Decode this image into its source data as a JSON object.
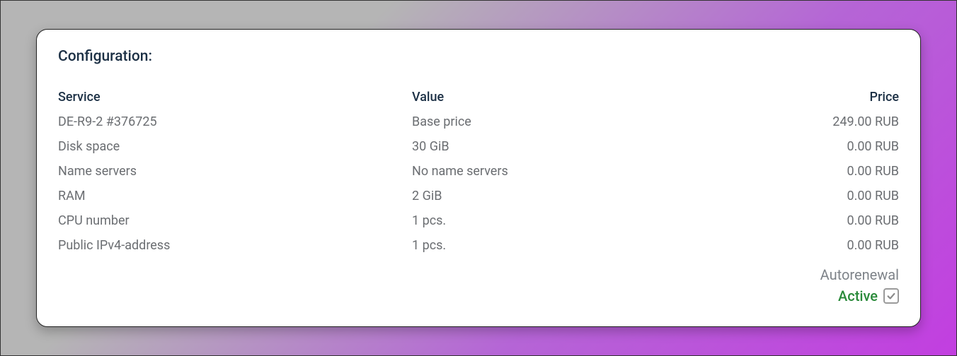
{
  "title": "Configuration:",
  "headers": {
    "service": "Service",
    "value": "Value",
    "price": "Price"
  },
  "rows": [
    {
      "service": "DE-R9-2 #376725",
      "value": "Base price",
      "price": "249.00 RUB"
    },
    {
      "service": "Disk space",
      "value": "30 GiB",
      "price": "0.00 RUB"
    },
    {
      "service": "Name servers",
      "value": "No name servers",
      "price": "0.00 RUB"
    },
    {
      "service": "RAM",
      "value": "2 GiB",
      "price": "0.00 RUB"
    },
    {
      "service": "CPU number",
      "value": "1 pcs.",
      "price": "0.00 RUB"
    },
    {
      "service": "Public IPv4-address",
      "value": "1 pcs.",
      "price": "0.00 RUB"
    }
  ],
  "footer": {
    "autorenewal": "Autorenewal",
    "active": "Active"
  }
}
